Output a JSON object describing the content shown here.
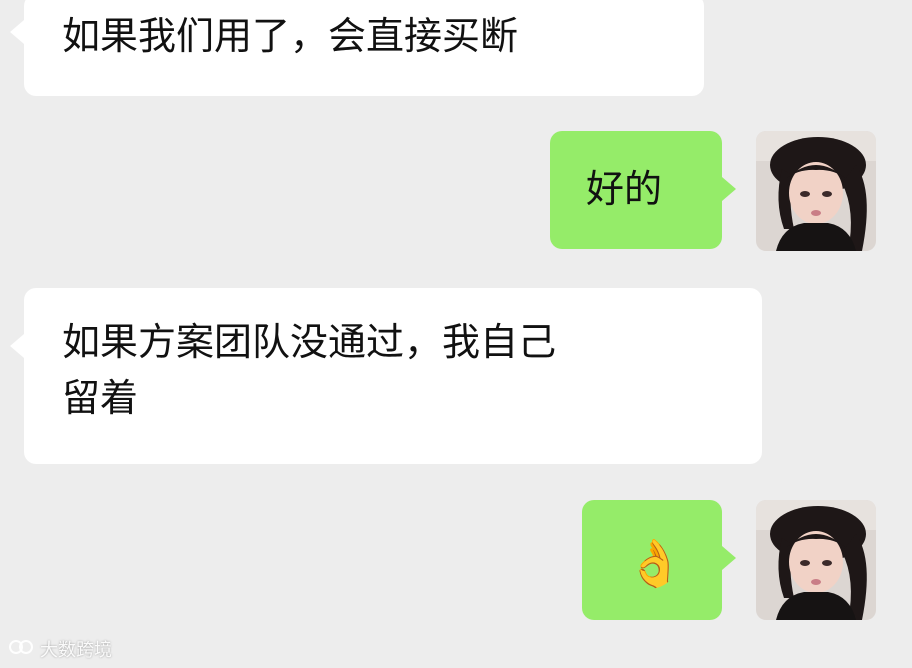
{
  "messages": [
    {
      "text": "如果我们用了，会直接买断"
    },
    {
      "text": "好的"
    },
    {
      "line1": "如果方案团队没通过，我自己",
      "line2": "留着"
    },
    {
      "emoji": "👌"
    }
  ],
  "watermark": {
    "text": "大数跨境"
  },
  "colors": {
    "background": "#ededed",
    "incoming_bubble": "#ffffff",
    "outgoing_bubble": "#95ec69"
  },
  "icons": {
    "watermark_logo": "brand-logo-icon"
  }
}
